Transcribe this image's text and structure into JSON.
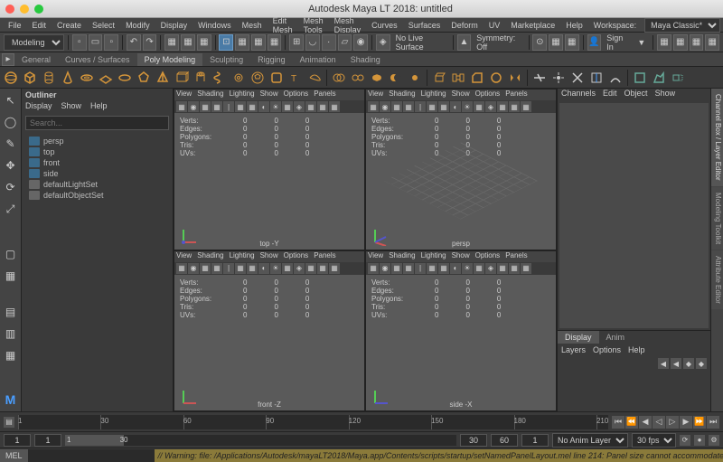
{
  "title": "Autodesk Maya LT 2018: untitled",
  "menubar": [
    "File",
    "Edit",
    "Create",
    "Select",
    "Modify",
    "Display",
    "Windows",
    "Mesh",
    "Edit Mesh",
    "Mesh Tools",
    "Mesh Display",
    "Curves",
    "Surfaces",
    "Deform",
    "UV",
    "Marketplace",
    "Help"
  ],
  "workspace_label": "Workspace:",
  "workspace": "Maya Classic*",
  "mode": "Modeling",
  "no_live_surface": "No Live Surface",
  "symmetry": "Symmetry: Off",
  "signin": "Sign In",
  "shelf_tabs": [
    "General",
    "Curves / Surfaces",
    "Poly Modeling",
    "Sculpting",
    "Rigging",
    "Animation",
    "Shading"
  ],
  "shelf_active": 2,
  "outliner": {
    "title": "Outliner",
    "menu": [
      "Display",
      "Show",
      "Help"
    ],
    "search_placeholder": "Search...",
    "items": [
      {
        "label": "persp",
        "cam": true
      },
      {
        "label": "top",
        "cam": true
      },
      {
        "label": "front",
        "cam": true
      },
      {
        "label": "side",
        "cam": true
      },
      {
        "label": "defaultLightSet",
        "cam": false
      },
      {
        "label": "defaultObjectSet",
        "cam": false
      }
    ]
  },
  "vp_menu": [
    "View",
    "Shading",
    "Lighting",
    "Show",
    "Options",
    "Panels"
  ],
  "stats": [
    "Verts:",
    "Edges:",
    "Polygons:",
    "Tris:",
    "UVs:"
  ],
  "stat_vals": [
    "0",
    "0",
    "0"
  ],
  "vp_labels": [
    "top -Y",
    "persp",
    "front -Z",
    "side -X"
  ],
  "channel_menu": [
    "Channels",
    "Edit",
    "Object",
    "Show"
  ],
  "layer_tabs": [
    "Display",
    "Anim"
  ],
  "layer_menu": [
    "Layers",
    "Options",
    "Help"
  ],
  "right_tabs": [
    "Channel Box / Layer Editor",
    "Modeling Toolkit",
    "Attribute Editor"
  ],
  "time_ticks": [
    1,
    30,
    60,
    90,
    120,
    150,
    180,
    210
  ],
  "range": {
    "start": "1",
    "disp_start": "1",
    "disp_end": "30",
    "mid1": "30",
    "mid2": "60",
    "end": "1"
  },
  "anim_layer": "No Anim Layer",
  "fps": "30 fps",
  "mel": "MEL",
  "warning": "// Warning: file: /Applications/Autodesk/mayaLT2018/Maya.app/Contents/scripts/startup/setNamedPanelLayout.mel line 214: Panel size cannot accommodate all re"
}
